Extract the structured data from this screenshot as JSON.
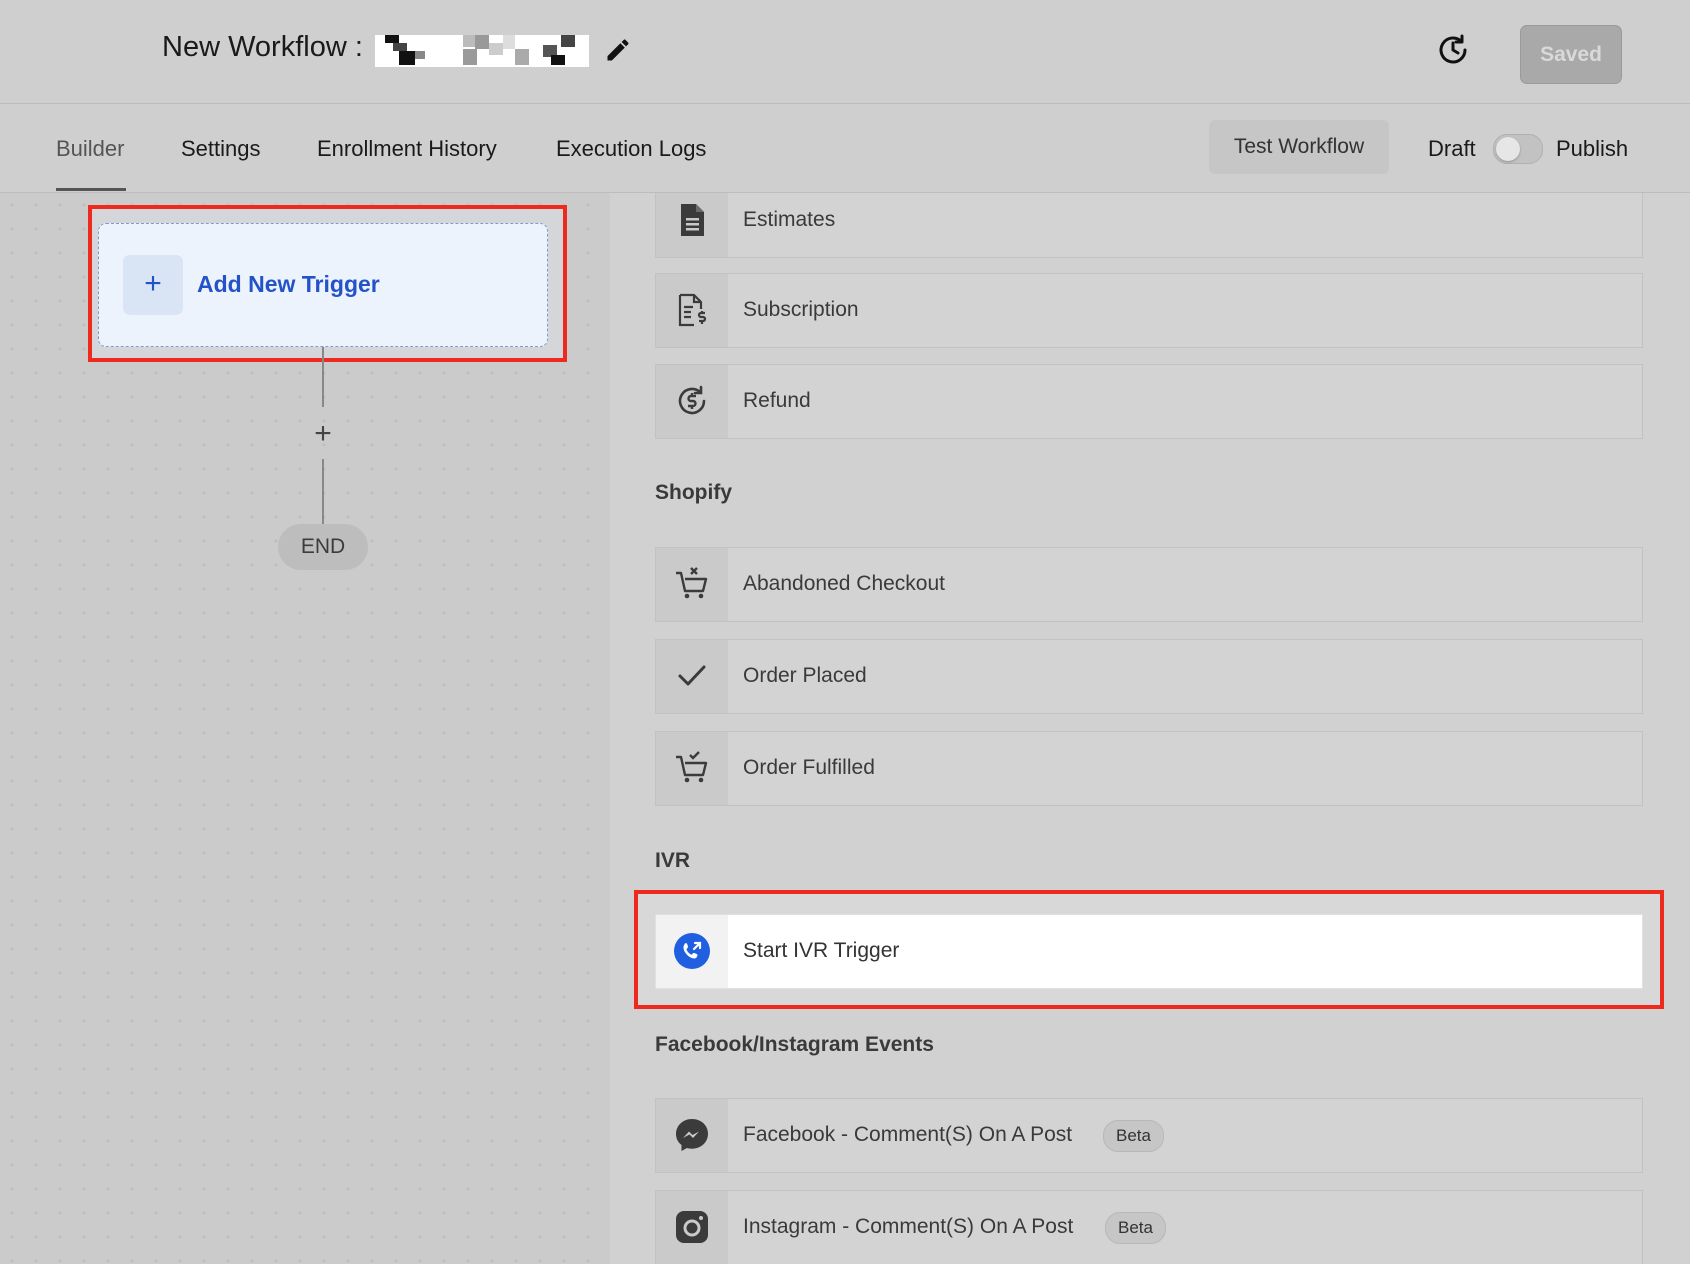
{
  "header": {
    "title": "New Workflow :",
    "saved_label": "Saved"
  },
  "tabs": [
    {
      "label": "Builder",
      "active": true
    },
    {
      "label": "Settings",
      "active": false
    },
    {
      "label": "Enrollment History",
      "active": false
    },
    {
      "label": "Execution Logs",
      "active": false
    }
  ],
  "toolbar": {
    "test_workflow_label": "Test Workflow",
    "draft_label": "Draft",
    "publish_label": "Publish",
    "publish_toggle_on": false
  },
  "builder": {
    "add_trigger_label": "Add New Trigger",
    "add_step_glyph": "+",
    "end_label": "END"
  },
  "panel": {
    "items_top": [
      {
        "label": "Estimates",
        "icon": "document-icon"
      },
      {
        "label": "Subscription",
        "icon": "invoice-dollar-icon"
      },
      {
        "label": "Refund",
        "icon": "refund-icon"
      }
    ],
    "shopify": {
      "heading": "Shopify",
      "items": [
        {
          "label": "Abandoned Checkout",
          "icon": "cart-x-icon"
        },
        {
          "label": "Order Placed",
          "icon": "checkmark-icon"
        },
        {
          "label": "Order Fulfilled",
          "icon": "cart-check-icon"
        }
      ]
    },
    "ivr": {
      "heading": "IVR",
      "items": [
        {
          "label": "Start IVR Trigger",
          "icon": "phone-call-icon"
        }
      ]
    },
    "social": {
      "heading": "Facebook/Instagram Events",
      "items": [
        {
          "label": "Facebook - Comment(S) On A Post",
          "badge": "Beta",
          "icon": "messenger-icon"
        },
        {
          "label": "Instagram - Comment(S) On A Post",
          "badge": "Beta",
          "icon": "instagram-icon"
        }
      ]
    }
  },
  "colors": {
    "highlight": "#ee2a1f",
    "trigger_blue": "#2452c7",
    "ivr_icon_blue": "#1f5fe0"
  }
}
